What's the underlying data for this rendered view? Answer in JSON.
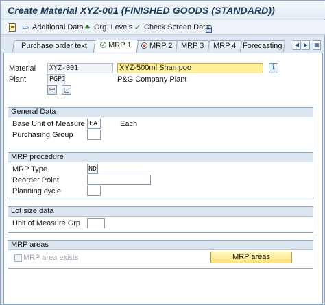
{
  "window": {
    "title": "Create Material XYZ-001 (FINISHED GOODS (STANDARD))"
  },
  "toolbar": {
    "items": [
      {
        "label": "Additional Data",
        "icon": "additional-data-icon"
      },
      {
        "label": "Org. Levels",
        "icon": "org-levels-icon"
      },
      {
        "label": "Check Screen Data",
        "icon": "check-icon"
      }
    ]
  },
  "tabs": [
    {
      "label": "Purchase order text"
    },
    {
      "label": "MRP 1",
      "active": true,
      "status": "ok"
    },
    {
      "label": "MRP 2",
      "status": "dot"
    },
    {
      "label": "MRP 3"
    },
    {
      "label": "MRP 4"
    },
    {
      "label": "Forecasting"
    }
  ],
  "header": {
    "material_label": "Material",
    "material_value": "XYZ-001",
    "material_desc": "XYZ-500ml Shampoo",
    "plant_label": "Plant",
    "plant_value": "PGP1",
    "plant_desc": "P&G Company Plant"
  },
  "general_data": {
    "title": "General Data",
    "base_uom_label": "Base Unit of Measure",
    "base_uom_value": "EA",
    "base_uom_text": "Each",
    "purch_group_label": "Purchasing Group",
    "purch_group_value": ""
  },
  "mrp_procedure": {
    "title": "MRP procedure",
    "mrp_type_label": "MRP Type",
    "mrp_type_value": "ND",
    "reorder_label": "Reorder Point",
    "reorder_value": "",
    "planning_cycle_label": "Planning cycle",
    "planning_cycle_value": ""
  },
  "lot_size": {
    "title": "Lot size data",
    "uom_grp_label": "Unit of Measure Grp",
    "uom_grp_value": ""
  },
  "mrp_areas": {
    "title": "MRP areas",
    "exists_label": "MRP area exists",
    "button_label": "MRP areas"
  },
  "colors": {
    "highlight": "#ffef9c",
    "yellow_button": "#ffe27a",
    "group_header": "#dbe5f0",
    "title_text": "#1f3a60"
  }
}
